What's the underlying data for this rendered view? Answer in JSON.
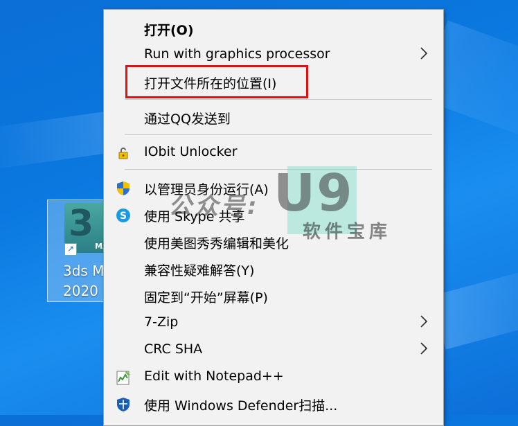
{
  "desktop": {
    "icon": {
      "label_line1": "3ds M",
      "label_line2": "2020",
      "tile_glyph": "3",
      "tile_badge": "MA",
      "shortcut_glyph": "↗"
    }
  },
  "context_menu": {
    "items": [
      {
        "label": "打开(O)",
        "icon": "",
        "submenu": false,
        "bold": true
      },
      {
        "label": "Run with graphics processor",
        "icon": "",
        "submenu": true
      },
      {
        "label": "打开文件所在的位置(I)",
        "icon": "",
        "submenu": false,
        "highlighted": true
      },
      {
        "label": "通过QQ发送到",
        "icon": "",
        "submenu": false
      },
      {
        "label": "IObit Unlocker",
        "icon": "lock-icon",
        "submenu": false
      },
      {
        "label": "以管理员身份运行(A)",
        "icon": "uac-shield-icon",
        "submenu": false
      },
      {
        "label": "使用 Skype 共享",
        "icon": "skype-icon",
        "submenu": false
      },
      {
        "label": "使用美图秀秀编辑和美化",
        "icon": "",
        "submenu": false
      },
      {
        "label": "兼容性疑难解答(Y)",
        "icon": "",
        "submenu": false
      },
      {
        "label": "固定到“开始”屏幕(P)",
        "icon": "",
        "submenu": false
      },
      {
        "label": "7-Zip",
        "icon": "",
        "submenu": true
      },
      {
        "label": "CRC SHA",
        "icon": "",
        "submenu": true
      },
      {
        "label": "Edit with Notepad++",
        "icon": "notepadpp-icon",
        "submenu": false
      },
      {
        "label": "使用 Windows Defender扫描...",
        "icon": "defender-shield-icon",
        "submenu": false
      }
    ],
    "submenu_arrow": "›",
    "highlight_color": "#e01010"
  },
  "watermark": {
    "account_text": "公众号:",
    "brand": "U9",
    "subtitle": "软件宝库"
  }
}
